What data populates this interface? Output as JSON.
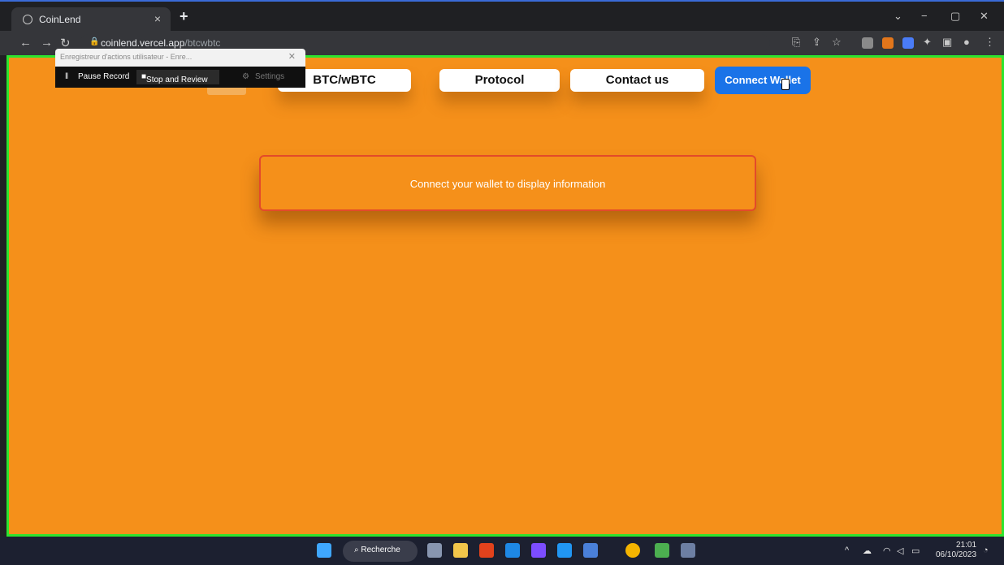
{
  "browser": {
    "tab_title": "CoinLend",
    "tab_close": "×",
    "new_tab": "+",
    "url_host": "coinlend.vercel.app",
    "url_path": "/btcwbtc",
    "window_controls": [
      "⌄",
      "−",
      "▢",
      "✕"
    ]
  },
  "recorder": {
    "title": "Enregistreur d'actions utilisateur - Enre...",
    "close": "✕",
    "pause_label": "Pause Record",
    "stop_label": "Stop and Review",
    "settings_label": "Settings"
  },
  "page": {
    "nav": {
      "btc_label": "BTC/wBTC",
      "protocol_label": "Protocol",
      "contact_label": "Contact us",
      "connect_label": "Connect Wallet"
    },
    "info_message": "Connect your wallet to display information"
  },
  "taskbar": {
    "search_label": "Recherche",
    "time": "21:01",
    "date": "06/10/2023"
  },
  "colors": {
    "page_bg": "#f5901a",
    "connect_button": "#1a73e8",
    "info_border": "#e34a2a",
    "viewport_outline": "#2ee42e"
  }
}
